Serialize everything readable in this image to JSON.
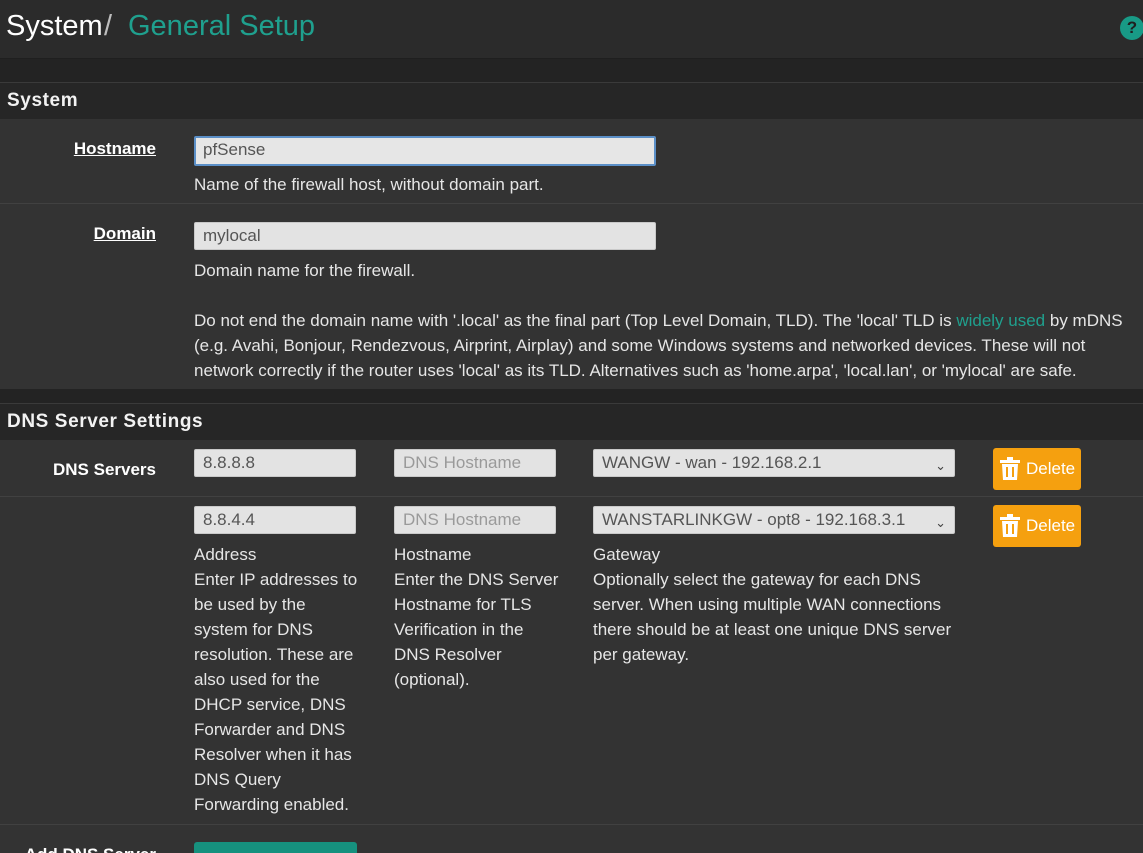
{
  "breadcrumb": {
    "root": "System",
    "separator": "/",
    "current": "General Setup"
  },
  "help_icon_glyph": "?",
  "sections": {
    "system": {
      "title": "System",
      "hostname": {
        "label": "Hostname",
        "value": "pfSense",
        "help": "Name of the firewall host, without domain part."
      },
      "domain": {
        "label": "Domain",
        "value": "mylocal",
        "help1": "Domain name for the firewall.",
        "help2_before": "Do not end the domain name with '.local' as the final part (Top Level Domain, TLD). The 'local' TLD is ",
        "help2_link": "widely used",
        "help2_after": " by mDNS (e.g. Avahi, Bonjour, Rendezvous, Airprint, Airplay) and some Windows systems and networked devices. These will not network correctly if the router uses 'local' as its TLD. Alternatives such as 'home.arpa', 'local.lan', or 'mylocal' are safe."
      }
    },
    "dns": {
      "title": "DNS Server Settings",
      "servers_label": "DNS Servers",
      "hostname_placeholder": "DNS Hostname",
      "delete_label": "Delete",
      "rows": [
        {
          "address": "8.8.8.8",
          "gateway": "WANGW - wan - 192.168.2.1"
        },
        {
          "address": "8.8.4.4",
          "gateway": "WANSTARLINKGW - opt8 - 192.168.3.1"
        }
      ],
      "address_help_title": "Address",
      "address_help": "Enter IP addresses to be used by the system for DNS resolution. These are also used for the DHCP service, DNS Forwarder and DNS Resolver when it has DNS Query Forwarding enabled.",
      "hostname_help_title": "Hostname",
      "hostname_help": "Enter the DNS Server Hostname for TLS Verification in the DNS Resolver (optional).",
      "gateway_help_title": "Gateway",
      "gateway_help": "Optionally select the gateway for each DNS server. When using multiple WAN connections there should be at least one unique DNS server per gateway.",
      "add_label": "Add DNS Server"
    }
  },
  "icons": {
    "help": "help-circle-icon",
    "delete": "trash-icon",
    "select": "chevron-down-icon"
  },
  "colors": {
    "accent": "#1fa08e",
    "delete": "#f5a00f",
    "background": "#333333"
  }
}
